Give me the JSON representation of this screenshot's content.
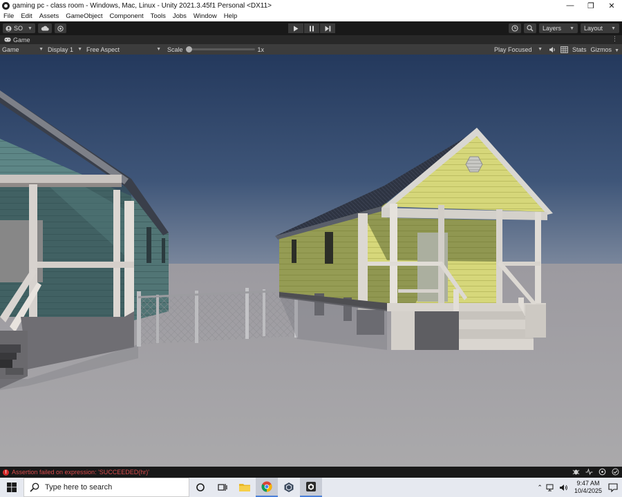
{
  "window": {
    "title": "gaming pc - class room - Windows, Mac, Linux - Unity 2021.3.45f1 Personal <DX11>",
    "controls": [
      "minimize-icon",
      "restore-icon",
      "close-icon"
    ]
  },
  "menu": [
    "File",
    "Edit",
    "Assets",
    "GameObject",
    "Component",
    "Tools",
    "Jobs",
    "Window",
    "Help"
  ],
  "toolbar": {
    "account_label": "SO",
    "right": {
      "layers": "Layers",
      "layout": "Layout"
    }
  },
  "game_tab": {
    "label": "Game"
  },
  "game_controls": {
    "view": "Game",
    "display": "Display 1",
    "aspect": "Free Aspect",
    "scale_label": "Scale",
    "scale_value": "1x",
    "scale_fraction": 0.0,
    "play_mode": "Play Focused",
    "stats": "Stats",
    "gizmos": "Gizmos"
  },
  "console": {
    "message": "Assertion failed on expression: 'SUCCEEDED(hr)'",
    "status_color": "#d42b2b"
  },
  "taskbar": {
    "search_placeholder": "Type here to search",
    "time": "9:47 AM",
    "date": "10/4/2025",
    "apps": [
      "cortana-icon",
      "task-view-icon",
      "file-explorer-icon",
      "chrome-icon",
      "unity-hub-icon",
      "unity-editor-icon"
    ]
  },
  "colors": {
    "accent": "#4a7fd9",
    "sky_top": "#24395d",
    "sky_horizon": "#6f7f98",
    "ground": "#a7a6a8",
    "house_teal": "#5d8686",
    "house_yellow": "#d6d77a"
  }
}
